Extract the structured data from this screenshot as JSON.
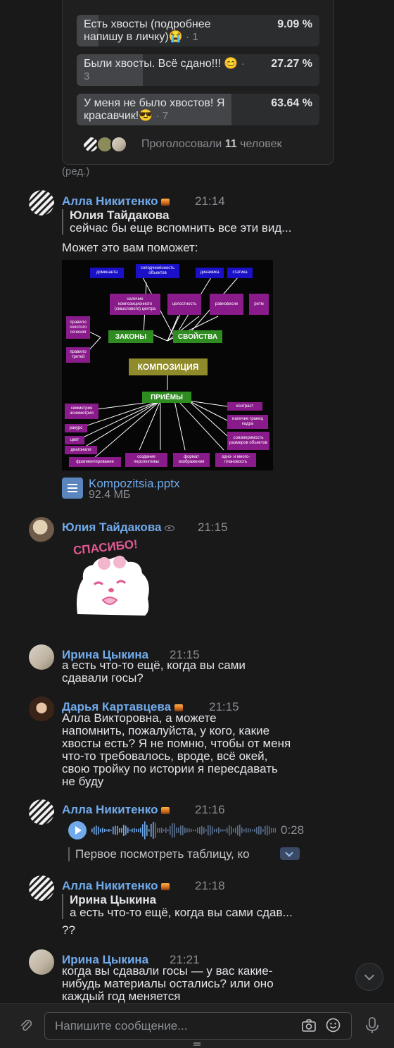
{
  "poll": {
    "options": [
      {
        "text": "Есть хвосты (подробнее напишу в личку)😭",
        "count": "· 1",
        "percent": "9.09 %",
        "fraction": 0.0909
      },
      {
        "text": "Были хвосты. Всё сдано!!! 😊",
        "count": "· 3",
        "percent": "27.27 %",
        "fraction": 0.2727
      },
      {
        "text": "У меня не было хвостов! Я красавчик!😎",
        "count": "· 7",
        "percent": "63.64 %",
        "fraction": 0.6364
      }
    ],
    "voted_prefix": "Проголосовали",
    "voted_count": "11",
    "voted_suffix": "человек"
  },
  "edited_label": "(ред.)",
  "messages": {
    "m1": {
      "author": "Алла Никитенко",
      "time": "21:14",
      "quote_author": "Юлия Тайдакова",
      "quote_text": "сейчас бы еще вспомнить все эти вид...",
      "text": "Может это вам поможет:"
    },
    "m2": {
      "author": "Юлия Тайдакова",
      "time": "21:15",
      "sticker_text": "СПАСИБО!"
    },
    "m3": {
      "author": "Ирина Цыкина",
      "time": "21:15",
      "text": "а есть что-то ещё, когда вы сами\nсдавали госы?"
    },
    "m4": {
      "author": "Дарья Картавцева",
      "time": "21:15",
      "text": "Алла Викторовна, а можете\nнапомнить, пожалуйста, у кого, какие\nхвосты есть? Я не помню, чтобы от меня\nчто-то требовалось, вроде, всё окей,\nсвою тройку по истории я пересдавать\nне буду"
    },
    "m5": {
      "author": "Алла Никитенко",
      "time": "21:16",
      "voice_duration": "0:28",
      "transcript": "Первое посмотреть таблицу, ко"
    },
    "m6": {
      "author": "Алла Никитенко",
      "time": "21:18",
      "quote_author": "Ирина Цыкина",
      "quote_text": "а есть что-то ещё, когда вы сами сдав...",
      "text": "??"
    },
    "m7": {
      "author": "Ирина Цыкина",
      "time": "21:21",
      "text": "когда вы сдавали госы — у вас какие-\nнибудь материалы остались? или оно\nкаждый год меняется"
    }
  },
  "diagram": {
    "center": "КОМПОЗИЦИЯ",
    "laws": "ЗАКОНЫ",
    "properties": "СВОЙСТВА",
    "techniques": "ПРИЁМЫ",
    "dominanta": "доминанта",
    "subordination": "соподчинённость объектов",
    "center_composition": "наличие композиционного (смыслового) центра",
    "integrity": "целостность",
    "dynamics": "динамика",
    "statics": "статика",
    "balance": "равновесие",
    "rhythm": "ритм",
    "golden_section": "правило золотого сечения",
    "thirds": "правило третей",
    "symmetry": "симметрия асимметрия",
    "angle": "ракурс",
    "color": "цвет",
    "diagonals": "диагонали",
    "fragmentation": "фрагментирование",
    "perspective": "создание перспективы",
    "format": "формат изображения",
    "planes": "одно- и много-плановость",
    "contrast": "контраст",
    "frame_borders": "наличие границ кадра",
    "proportion": "соизмеримость размеров объектов"
  },
  "file": {
    "name": "Kompozitsia.pptx",
    "size": "92.4 МБ"
  },
  "composer": {
    "placeholder": "Напишите сообщение..."
  },
  "colors": {
    "background": "#19191a",
    "author": "#71aaeb",
    "accent": "#71aaeb"
  }
}
